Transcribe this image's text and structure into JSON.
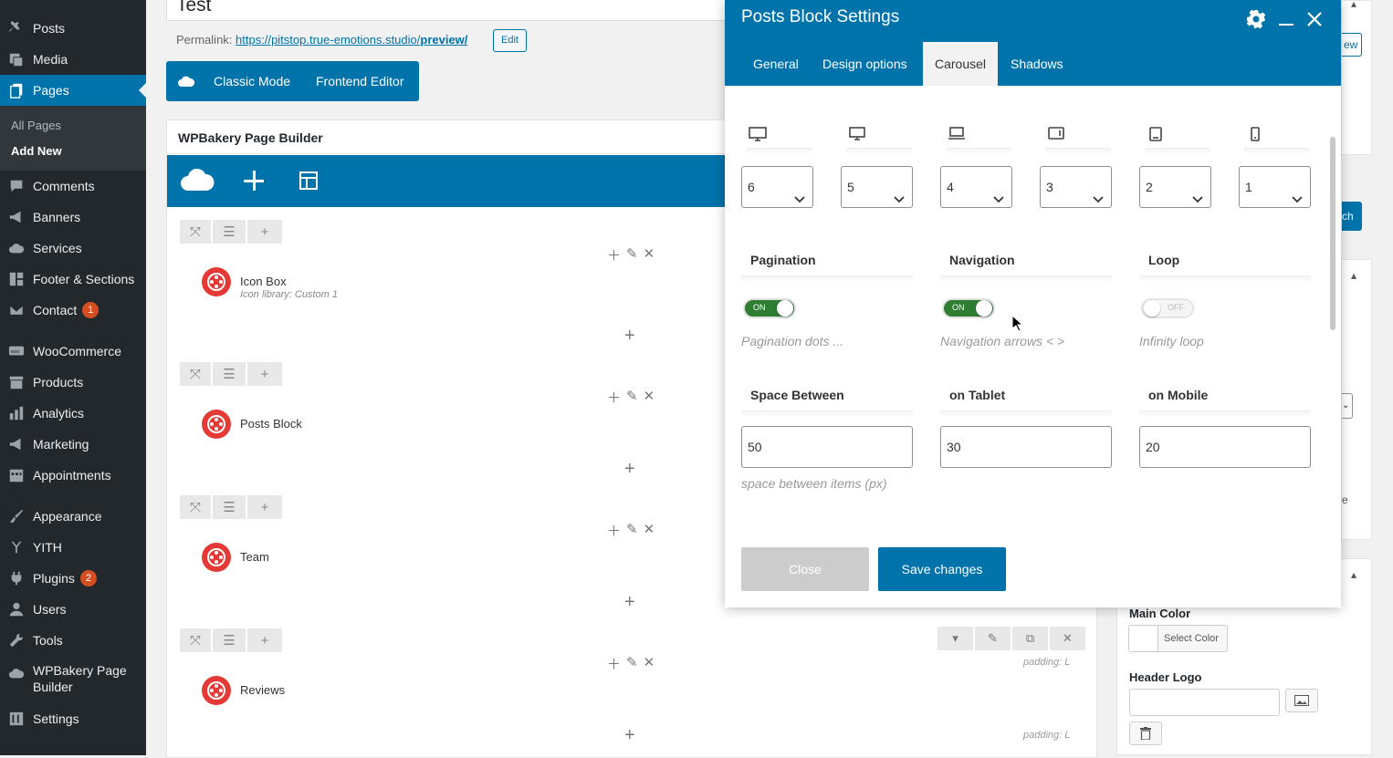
{
  "sidebar": {
    "items": [
      {
        "label": "Posts",
        "icon": "pin-icon"
      },
      {
        "label": "Media",
        "icon": "media-icon"
      },
      {
        "label": "Pages",
        "icon": "pages-icon"
      },
      {
        "label": "Comments",
        "icon": "comments-icon"
      },
      {
        "label": "Banners",
        "icon": "megaphone-icon"
      },
      {
        "label": "Services",
        "icon": "cloud-icon"
      },
      {
        "label": "Footer & Sections",
        "icon": "layout-icon"
      },
      {
        "label": "Contact",
        "icon": "mail-icon",
        "badge": "1"
      },
      {
        "label": "WooCommerce",
        "icon": "woo-icon"
      },
      {
        "label": "Products",
        "icon": "archive-icon"
      },
      {
        "label": "Analytics",
        "icon": "chart-icon"
      },
      {
        "label": "Marketing",
        "icon": "megaphone-icon"
      },
      {
        "label": "Appointments",
        "icon": "calendar-icon"
      },
      {
        "label": "Appearance",
        "icon": "brush-icon"
      },
      {
        "label": "YITH",
        "icon": "yith-icon"
      },
      {
        "label": "Plugins",
        "icon": "plug-icon",
        "badge": "2"
      },
      {
        "label": "Users",
        "icon": "user-icon"
      },
      {
        "label": "Tools",
        "icon": "wrench-icon"
      },
      {
        "label": "WPBakery Page",
        "label2": "Builder",
        "icon": "cloud-icon"
      },
      {
        "label": "Settings",
        "icon": "settings-icon"
      }
    ],
    "submenu": [
      "All Pages",
      "Add New"
    ]
  },
  "editor": {
    "title": "Test",
    "permalink_label": "Permalink:",
    "permalink_url": "https://pitstop.true-emotions.studio/",
    "permalink_slug": "preview/",
    "edit_label": "Edit",
    "classic_mode": "Classic Mode",
    "frontend_editor": "Frontend Editor",
    "builder_title": "WPBakery Page Builder",
    "elements": [
      {
        "name": "Icon Box",
        "sub": "Icon library: Custom 1"
      },
      {
        "name": "Posts Block",
        "sub": ""
      },
      {
        "name": "Team",
        "sub": ""
      },
      {
        "name": "Reviews",
        "sub": ""
      }
    ],
    "padding_note": "padding: L"
  },
  "right_panel": {
    "partial_view": "ew",
    "partial_btn": "ch",
    "partial_text": "e",
    "main_color_label": "Main Color",
    "select_color": "Select Color",
    "header_logo_label": "Header Logo"
  },
  "modal": {
    "title": "Posts Block Settings",
    "tabs": [
      "General",
      "Design options",
      "Carousel",
      "Shadows"
    ],
    "active_tab": "Carousel",
    "devices": [
      "desktop-large-icon",
      "desktop-icon",
      "laptop-icon",
      "tablet-landscape-icon",
      "tablet-portrait-icon",
      "mobile-icon"
    ],
    "columns": [
      "6",
      "5",
      "4",
      "3",
      "2",
      "1"
    ],
    "pagination": {
      "label": "Pagination",
      "state": "ON",
      "desc": "Pagination dots ..."
    },
    "navigation": {
      "label": "Navigation",
      "state": "ON",
      "desc": "Navigation arrows < >"
    },
    "loop": {
      "label": "Loop",
      "state": "OFF",
      "desc": "Infinity loop"
    },
    "space_between": {
      "label": "Space Between",
      "value": "50",
      "desc": "space between items (px)"
    },
    "on_tablet": {
      "label": "on Tablet",
      "value": "30"
    },
    "on_mobile": {
      "label": "on Mobile",
      "value": "20"
    },
    "close_label": "Close",
    "save_label": "Save changes"
  }
}
